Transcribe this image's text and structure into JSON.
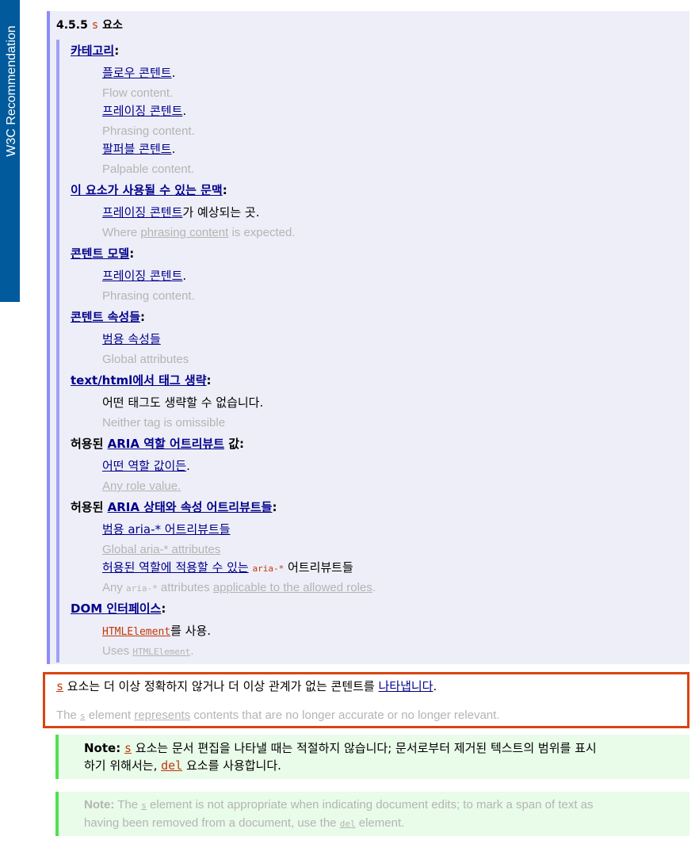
{
  "badge": "W3C Recommendation",
  "heading": {
    "number": "4.5.5",
    "code": "s",
    "text": "요소"
  },
  "sections": [
    {
      "term": "카테고리",
      "colon": ":",
      "items": [
        {
          "ko_link": "플로우 콘텐트",
          "ko_tail": ".",
          "en": "Flow content."
        },
        {
          "ko_link": "프레이징 콘텐트",
          "ko_tail": ".",
          "en": "Phrasing content."
        },
        {
          "ko_link": "팔퍼블 콘텐트",
          "ko_tail": ".",
          "en": "Palpable content."
        }
      ]
    },
    {
      "term": "이 요소가 사용될 수 있는 문맥",
      "colon": ":",
      "items": [
        {
          "ko_link": "프레이징 콘텐트",
          "ko_tail": "가 예상되는 곳.",
          "en_pre": "Where ",
          "en_link": "phrasing content",
          "en_post": " is expected."
        }
      ]
    },
    {
      "term": "콘텐트 모델",
      "colon": ":",
      "items": [
        {
          "ko_link": "프레이징 콘텐트",
          "ko_tail": ".",
          "en": "Phrasing content."
        }
      ]
    },
    {
      "term": "콘텐트 속성들",
      "colon": ":",
      "items": [
        {
          "ko_link": "범용 속성들",
          "ko_tail": "",
          "en": "Global attributes"
        }
      ]
    },
    {
      "term": "text/html에서 태그 생략",
      "colon": ":",
      "items": [
        {
          "ko_text": "어떤 태그도 생략할 수 없습니다.",
          "en": "Neither tag is omissible"
        }
      ]
    },
    {
      "term_pre": "허용된 ",
      "term_link": "ARIA 역할 어트리뷰트",
      "term_post": " 값:",
      "items": [
        {
          "ko_link": "어떤 역할 값이든",
          "ko_tail": ".",
          "en": "Any role value."
        }
      ]
    },
    {
      "term_pre": "허용된 ",
      "term_link": "ARIA 상태와 속성 어트리뷰트들",
      "term_post": ":",
      "items": [
        {
          "ko_link": "범용 aria-* 어트리뷰트들",
          "ko_tail": "",
          "en": "Global aria-* attributes"
        },
        {
          "ko_link": "허용된 역할에 적용할 수 있는",
          "ko_code": "aria-*",
          "ko_tail": " 어트리뷰트들",
          "en_pre": "Any ",
          "en_code": "aria-*",
          "en_mid": " attributes ",
          "en_link": "applicable to the allowed roles",
          "en_post": "."
        }
      ]
    },
    {
      "term": "DOM 인터페이스",
      "colon": ":",
      "items": [
        {
          "ko_code": "HTMLElement",
          "ko_tail": "를 사용.",
          "en_pre": "Uses ",
          "en_code": "HTMLElement",
          "en_post": "."
        }
      ]
    }
  ],
  "highlight": {
    "ko_code": "s",
    "ko_text": " 요소는 더 이상 정확하지 않거나 더 이상 관계가 없는 콘텐트를 ",
    "ko_link": "나타냅니다",
    "ko_end": ".",
    "en_pre": "The ",
    "en_code": "s",
    "en_mid": " element ",
    "en_link": "represents",
    "en_post": " contents that are no longer accurate or no longer relevant."
  },
  "note_ko": {
    "label": "Note:",
    "code1": "s",
    "text1": " 요소는 문서 편집을 나타낼 때는 적절하지 않습니다; 문서로부터 제거된 텍스트의 범위를 표시",
    "text2": "하기 위해서는, ",
    "code2": "del",
    "text3": " 요소를 사용합니다."
  },
  "note_en": {
    "label": "Note:",
    "text1": " The ",
    "code1": "s",
    "text2": " element is not appropriate when indicating document edits; to mark a span of text as",
    "text3": "having been removed from a document, use the ",
    "code2": "del",
    "text4": " element."
  },
  "colors": {
    "badge": "#005a9c",
    "panel": "#eeeef8",
    "panel_border": "#8c8cf8",
    "link": "#00008b",
    "code": "#c0390a",
    "highlight_border": "#d94410",
    "note_bg": "#e9fbe9",
    "note_border": "#52e052"
  }
}
